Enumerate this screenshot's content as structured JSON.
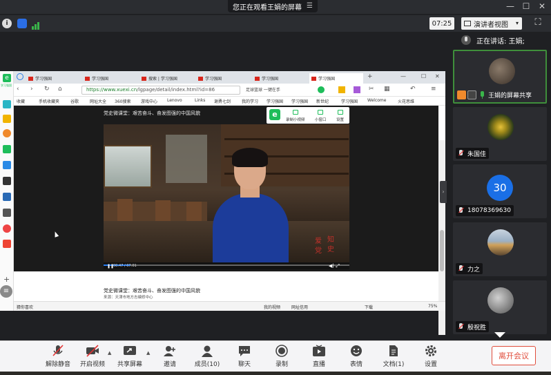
{
  "topbar": {
    "sharing_label": "您正在观看王娟的屏幕",
    "minimize": "—",
    "maximize": "☐",
    "close": "✕"
  },
  "secondbar": {
    "timer": "07:25",
    "presenter_view": "演讲者视图",
    "dropdown": "▾",
    "fullscreen": "⛶"
  },
  "speaking": {
    "label": "正在讲话: 王娟;"
  },
  "participants": [
    {
      "name": "王娟的屏幕共享",
      "type": "share"
    },
    {
      "name": "朱国佳"
    },
    {
      "name": "18078369630",
      "avatar_text": "30"
    },
    {
      "name": "力之"
    },
    {
      "name": "殷祝胜"
    }
  ],
  "shared_browser": {
    "tabs": [
      "学习强国",
      "学习强国",
      "搜索 | 学习强国",
      "学习强国",
      "学习强国",
      "学习强国"
    ],
    "url_main": "https://www.xuexi.cn",
    "url_rest": "/lgpage/detail/index.html?id=86",
    "search_text": "足球篮球 一键在手",
    "bookmarks": [
      "收藏",
      "手机收藏夹",
      "谷歌",
      "网址大全",
      "360搜索",
      "游戏中心",
      "Lenovo",
      "Links",
      "谢勇七剑",
      "我的学习",
      "学习强国",
      "学习强国",
      "新世纪",
      "学习强国",
      "Welcome",
      "火花思维"
    ],
    "video_title": "党史微课堂：艰苦奋斗、奋发图强的中国风貌",
    "video_tools": [
      "录制小视频",
      "小窗口",
      "设置"
    ],
    "seal_chars": [
      "知",
      "史",
      "爱",
      "党"
    ],
    "video_time": "00:47 / 07:01",
    "progress": 0.11,
    "below_title": "党史微课堂：艰苦奋斗、奋发图强的中国风貌",
    "below_source": "来源：天津市地方志编修中心",
    "status_left": "猜你喜欢",
    "status_items": [
      "我的视频",
      "网址信用",
      "下载",
      "75%"
    ],
    "left_strip_label": "学习强国"
  },
  "toolbar": {
    "unmute": "解除静音",
    "start_video": "开启视频",
    "share_screen": "共享屏幕",
    "invite": "邀请",
    "members": "成员(10)",
    "chat": "聊天",
    "record": "录制",
    "live": "直播",
    "reaction": "表情",
    "docs": "文档(1)",
    "settings": "设置",
    "leave": "离开会议"
  },
  "colors": {
    "accent_blue": "#1a6fe6",
    "leave_red": "#e04b3a",
    "active_speaker": "#3f8f3b",
    "mute_red": "#e33333"
  }
}
